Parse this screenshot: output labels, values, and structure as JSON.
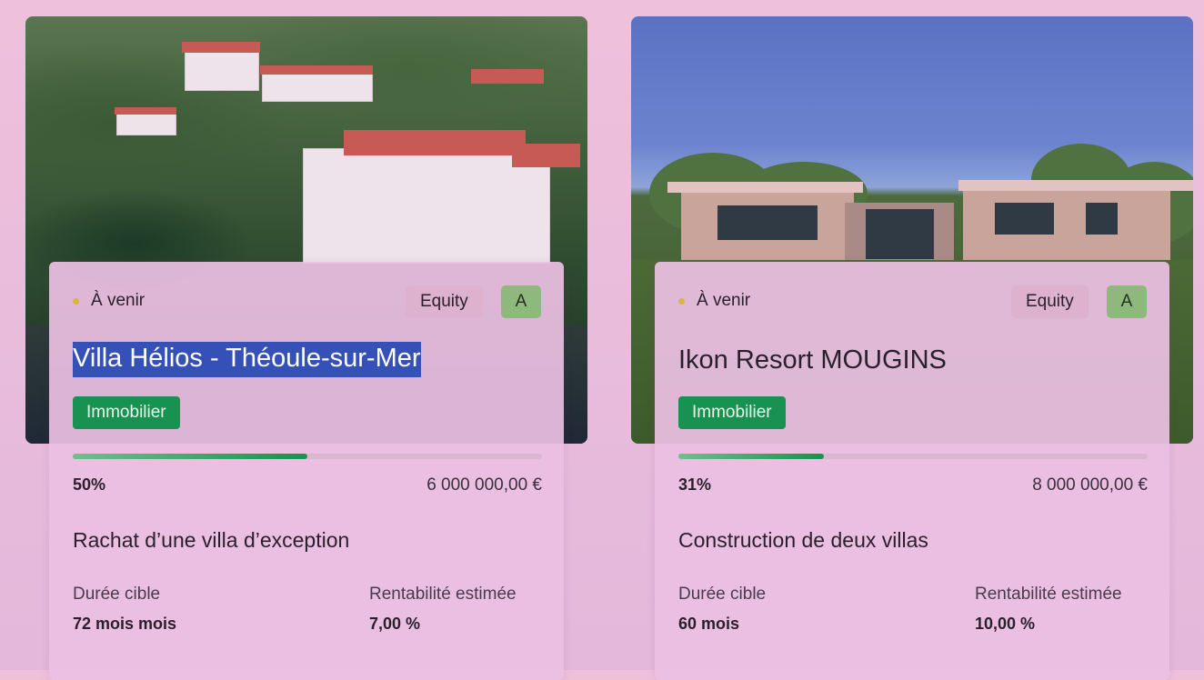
{
  "projects": [
    {
      "status": "À venir",
      "type_badge": "Equity",
      "grade": "A",
      "title": "Villa Hélios - Théoule-sur-Mer",
      "category": "Immobilier",
      "progress": 0.5,
      "progress_label": "50%",
      "amount": "6 000 000,00 €",
      "description": "Rachat d’une villa d’exception",
      "duration_label": "Durée cible",
      "duration_value": "72 mois mois",
      "return_label": "Rentabilité estimée",
      "return_value": "7,00 %"
    },
    {
      "status": "À venir",
      "type_badge": "Equity",
      "grade": "A",
      "title": "Ikon Resort MOUGINS",
      "category": "Immobilier",
      "progress": 0.31,
      "progress_label": "31%",
      "amount": "8 000 000,00 €",
      "description": "Construction de deux villas",
      "duration_label": "Durée cible",
      "duration_value": "60 mois",
      "return_label": "Rentabilité estimée",
      "return_value": "10,00 %"
    }
  ],
  "colors": {
    "accent_green": "#199150",
    "status_dot": "#d9b24a",
    "grade_badge": "#8fb97c",
    "selection": "#3551b8"
  }
}
